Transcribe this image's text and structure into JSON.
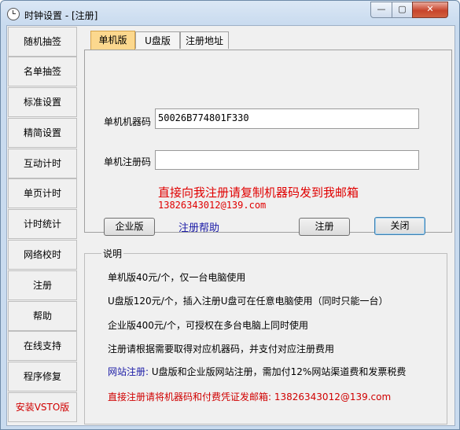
{
  "window": {
    "title": "时钟设置 - [注册]",
    "close_glyph": "✕",
    "min_glyph": "—",
    "max_glyph": "▢"
  },
  "sidebar": {
    "items": [
      {
        "label": "随机抽签",
        "color": "#000000"
      },
      {
        "label": "名单抽签",
        "color": "#000000"
      },
      {
        "label": "标准设置",
        "color": "#000000"
      },
      {
        "label": "精简设置",
        "color": "#000000"
      },
      {
        "label": "互动计时",
        "color": "#000000"
      },
      {
        "label": "单页计时",
        "color": "#000000"
      },
      {
        "label": "计时统计",
        "color": "#000000"
      },
      {
        "label": "网络校时",
        "color": "#000000"
      },
      {
        "label": "注册",
        "color": "#000000"
      },
      {
        "label": "帮助",
        "color": "#000000"
      },
      {
        "label": "在线支持",
        "color": "#000000"
      },
      {
        "label": "程序修复",
        "color": "#000000"
      },
      {
        "label": "安装VSTO版",
        "color": "#d00000"
      }
    ]
  },
  "tabs": [
    {
      "label": "单机版",
      "active": true
    },
    {
      "label": "U盘版",
      "active": false
    },
    {
      "label": "注册地址",
      "active": false
    }
  ],
  "form": {
    "machine_code_label": "单机机器码",
    "machine_code_value": "50026B774801F330",
    "reg_code_label": "单机注册码",
    "reg_code_value": "",
    "notice_line1": "直接向我注册请复制机器码发到我邮箱",
    "notice_line2": "13826343012@139.com"
  },
  "buttons": {
    "enterprise": "企业版",
    "register": "注册",
    "close": "关闭"
  },
  "help_link": "注册帮助",
  "description": {
    "title": "说明",
    "lines": [
      "单机版40元/个，仅一台电脑使用",
      "U盘版120元/个，插入注册U盘可在任意电脑使用（同时只能一台）",
      "企业版400元/个，可授权在多台电脑上同时使用",
      "注册请根据需要取得对应机器码，并支付对应注册费用"
    ],
    "website_label": "网站注册:",
    "website_text": " U盘版和企业版网站注册，需加付12%网站渠道费和发票税费",
    "email_line": "直接注册请将机器码和付费凭证发邮箱: 13826343012@139.com"
  }
}
